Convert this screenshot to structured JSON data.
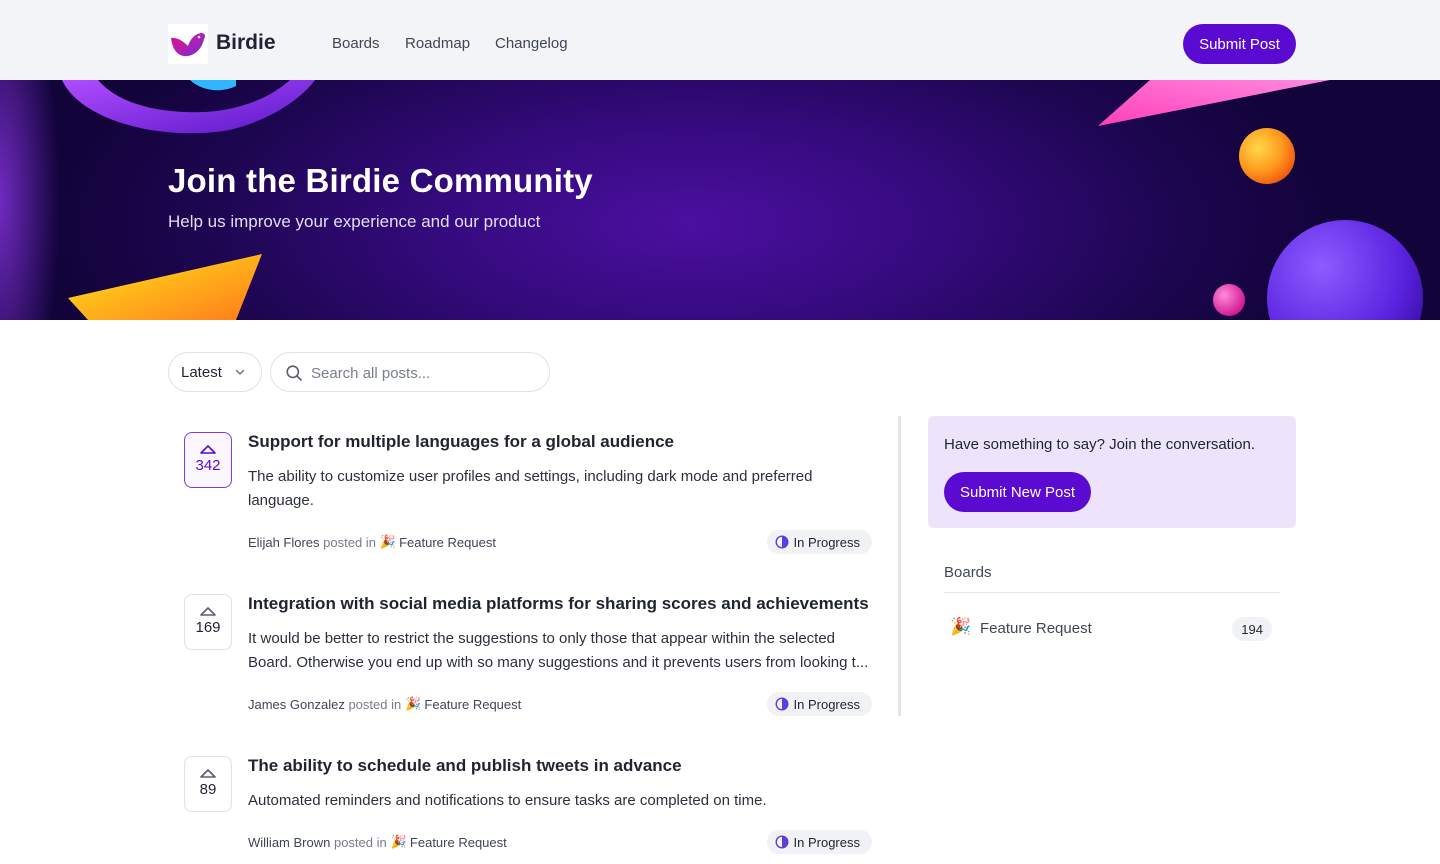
{
  "header": {
    "brand": "Birdie",
    "nav": [
      "Boards",
      "Roadmap",
      "Changelog"
    ],
    "submit_label": "Submit Post"
  },
  "hero": {
    "title": "Join the Birdie Community",
    "subtitle": "Help us improve your experience and our product"
  },
  "controls": {
    "sort_value": "Latest",
    "search_placeholder": "Search all posts..."
  },
  "posts": [
    {
      "votes": "342",
      "title": "Support for multiple languages for a global audience",
      "description": "The ability to customize user profiles and settings, including dark mode and preferred language.",
      "author": "Elijah Flores",
      "posted_in": "posted in",
      "board": "Feature Request",
      "status": "In Progress",
      "voted": true
    },
    {
      "votes": "169",
      "title": "Integration with social media platforms for sharing scores and achievements",
      "description": "It would be better to restrict the suggestions to only those that appear within the selected Board.  Otherwise you end up with so many suggestions and it prevents users from looking t...",
      "author": "James Gonzalez",
      "posted_in": "posted in",
      "board": "Feature Request",
      "status": "In Progress",
      "voted": false
    },
    {
      "votes": "89",
      "title": "The ability to schedule and publish tweets in advance",
      "description": "Automated reminders and notifications to ensure tasks are completed on time.",
      "author": "William Brown",
      "posted_in": "posted in",
      "board": "Feature Request",
      "status": "In Progress",
      "voted": false
    }
  ],
  "sidebar": {
    "cta_text": "Have something to say? Join the conversation.",
    "cta_button": "Submit New Post",
    "boards_heading": "Boards",
    "boards": [
      {
        "emoji": "🎉",
        "name": "Feature Request",
        "count": "194"
      }
    ]
  },
  "colors": {
    "accent": "#5b0ad1",
    "hero_background": "#340a7c",
    "cta_background": "#ede3fb",
    "status_icon": "#5b3fd8"
  },
  "icons": {
    "logo": "bird-logo-icon",
    "sort": "chevron-down-icon",
    "search": "search-icon",
    "vote": "upvote-arrow-icon",
    "status": "in-progress-icon",
    "board": "party-popper-icon"
  }
}
